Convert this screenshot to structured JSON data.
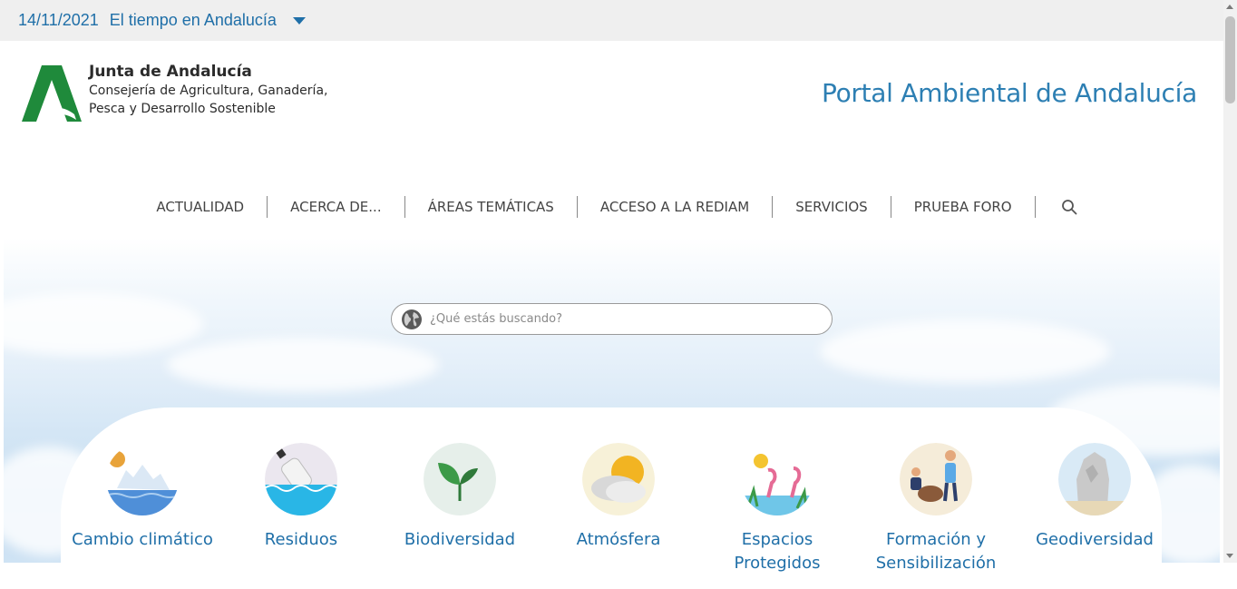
{
  "weather_bar": {
    "date": "14/11/2021",
    "title": "El tiempo en Andalucía"
  },
  "header": {
    "org_name": "Junta de Andalucía",
    "department": "Consejería de Agricultura, Ganadería, Pesca y Desarrollo Sostenible",
    "portal_title": "Portal Ambiental de Andalucía"
  },
  "nav": {
    "items": [
      {
        "label": "ACTUALIDAD"
      },
      {
        "label": "ACERCA DE..."
      },
      {
        "label": "ÁREAS TEMÁTICAS"
      },
      {
        "label": "ACCESO A LA REDIAM"
      },
      {
        "label": "SERVICIOS"
      },
      {
        "label": "PRUEBA FORO"
      }
    ],
    "search_icon": "search-icon"
  },
  "search": {
    "placeholder": "¿Qué estás buscando?",
    "value": ""
  },
  "topics": [
    {
      "label": "Cambio climático",
      "icon": "climate-change-icon"
    },
    {
      "label": "Residuos",
      "icon": "waste-icon"
    },
    {
      "label": "Biodiversidad",
      "icon": "biodiversity-icon"
    },
    {
      "label": "Atmósfera",
      "icon": "atmosphere-icon"
    },
    {
      "label": "Espacios Protegidos",
      "icon": "protected-areas-icon"
    },
    {
      "label": "Formación y Sensibilización",
      "icon": "training-icon"
    },
    {
      "label": "Geodiversidad",
      "icon": "geodiversity-icon"
    }
  ],
  "colors": {
    "link": "#1f6fa8",
    "brand_green": "#1f8a3b",
    "portal_title": "#2d7fb3"
  }
}
